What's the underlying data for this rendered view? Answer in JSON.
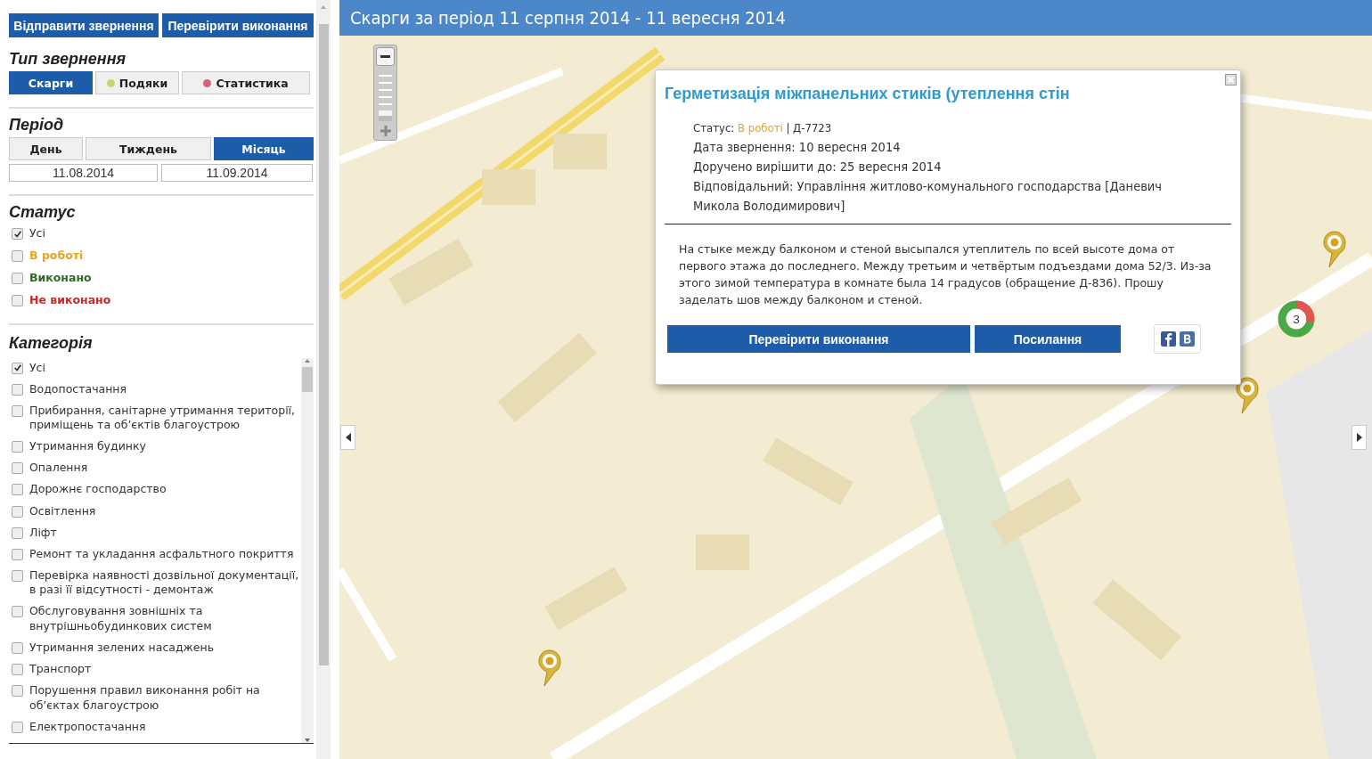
{
  "top_buttons": [
    "Відправити звернення",
    "Перевірити виконання"
  ],
  "request_type": {
    "title": "Тип звернення",
    "tabs": [
      {
        "label": "Скарги",
        "selected": true
      },
      {
        "label": "Подяки",
        "selected": false,
        "color": "#c9d46c"
      },
      {
        "label": "Статистика",
        "selected": false,
        "color": "#d8607c"
      }
    ]
  },
  "period": {
    "title": "Період",
    "tabs": [
      {
        "label": "День",
        "selected": false
      },
      {
        "label": "Тиждень",
        "selected": false
      },
      {
        "label": "Місяць",
        "selected": true
      }
    ],
    "date_from": "11.08.2014",
    "date_to": "11.09.2014"
  },
  "status": {
    "title": "Статус",
    "items": [
      {
        "label": "Усі",
        "checked": true,
        "color": "#333333"
      },
      {
        "label": "В роботі",
        "checked": false,
        "color": "#e8a320"
      },
      {
        "label": "Виконано",
        "checked": false,
        "color": "#2f6a22"
      },
      {
        "label": "Не виконано",
        "checked": false,
        "color": "#c42b25"
      }
    ]
  },
  "category": {
    "title": "Категорія",
    "items": [
      {
        "label": "Усі",
        "checked": true
      },
      {
        "label": "Водопостачання",
        "checked": false
      },
      {
        "label": "Прибирання, санітарне утримання території, приміщень та об’єктів благоустрою",
        "checked": false
      },
      {
        "label": "Утримання будинку",
        "checked": false
      },
      {
        "label": "Опалення",
        "checked": false
      },
      {
        "label": "Дорожнє господарство",
        "checked": false
      },
      {
        "label": "Освітлення",
        "checked": false
      },
      {
        "label": "Ліфт",
        "checked": false
      },
      {
        "label": "Ремонт та укладання асфальтного покриття",
        "checked": false
      },
      {
        "label": "Перевірка наявності дозвільної документації, в разі її відсутності - демонтаж",
        "checked": false
      },
      {
        "label": "Обслуговування зовнішніх та внутрішньобудинкових систем",
        "checked": false
      },
      {
        "label": "Утримання зелених насаджень",
        "checked": false
      },
      {
        "label": "Транспорт",
        "checked": false
      },
      {
        "label": "Порушення правил виконання робіт на об’єктах благоустрою",
        "checked": false
      },
      {
        "label": "Електропостачання",
        "checked": false
      }
    ]
  },
  "map": {
    "title": "Скарги за період 11 серпня 2014 - 11 вересня 2014",
    "zoom": {
      "level": 0.9
    },
    "cluster": {
      "count": "3"
    },
    "popup": {
      "title": "Герметизація міжпанельних стиків (утеплення стін",
      "status_label": "Статус:",
      "status_value": "В роботі",
      "code": "| Д-7723",
      "lines": [
        "Дата звернення: 10 вересня 2014",
        "Доручено вирішити до: 25 вересня 2014",
        "Відповідальний: Управління житлово-комунального господарства [Даневич Микола Володимирович]"
      ],
      "description": "На стыке между балконом и стеной высыпался утеплитель по всей высоте дома от первого этажа до последнего. Между третьим и четвёртым подъездами дома 52/3. Из-за этого зимой температура в комнате была 14 градусов (обращение Д-836). Прошу заделать шов между балконом и стеной.",
      "buttons": [
        "Перевірити виконання",
        "Посилання"
      ]
    }
  }
}
